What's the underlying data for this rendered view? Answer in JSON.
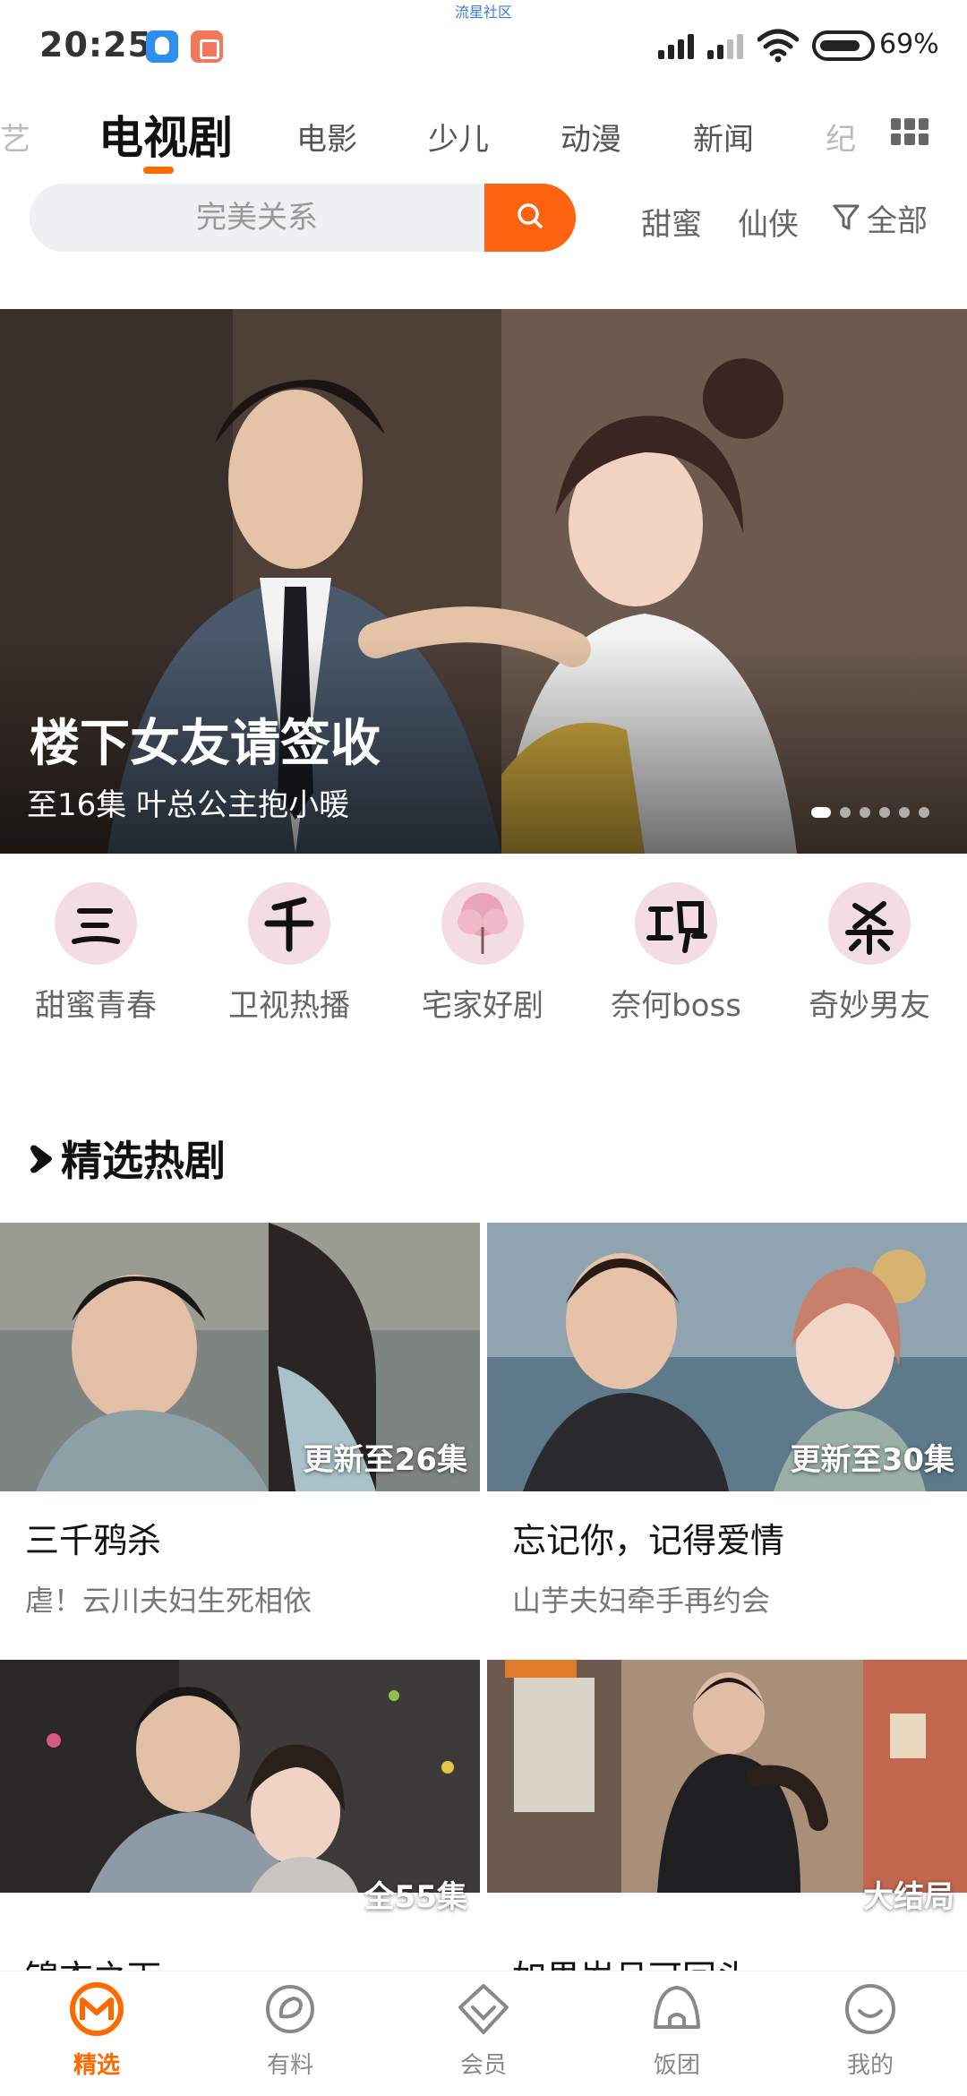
{
  "status_bar": {
    "watermark": "流星社区",
    "time": "20:25",
    "battery": "69%"
  },
  "tabs": {
    "items": [
      "艺",
      "电视剧",
      "电影",
      "少儿",
      "动漫",
      "新闻",
      "纪"
    ],
    "active": "电视剧"
  },
  "search": {
    "placeholder": "完美关系",
    "quick_tags": [
      "甜蜜",
      "仙侠"
    ],
    "filter_label": "全部"
  },
  "banner": {
    "title": "楼下女友请签收",
    "subtitle": "至16集 叶总公主抱小暖",
    "page_count": 6,
    "active_page": 1
  },
  "channels": [
    {
      "label": "甜蜜青春",
      "glyph": "三"
    },
    {
      "label": "卫视热播",
      "glyph": "千"
    },
    {
      "label": "宅家好剧",
      "glyph": ""
    },
    {
      "label": "奈何boss",
      "glyph": "鸦"
    },
    {
      "label": "奇妙男友",
      "glyph": "杀"
    }
  ],
  "section": {
    "title": "精选热剧"
  },
  "cards": [
    {
      "title": "三千鸦杀",
      "desc": "虐！云川夫妇生死相依",
      "badge": "更新至26集"
    },
    {
      "title": "忘记你，记得爱情",
      "desc": "山芋夫妇牵手再约会",
      "badge": "更新至30集"
    },
    {
      "title": "锦衣之下",
      "desc": "",
      "badge": "全55集"
    },
    {
      "title": "如果岁月可回头",
      "desc": "",
      "badge": "大结局"
    }
  ],
  "bottom_nav": {
    "items": [
      {
        "label": "精选",
        "icon": "home-m-icon",
        "active": true
      },
      {
        "label": "有料",
        "icon": "discover-icon",
        "active": false
      },
      {
        "label": "会员",
        "icon": "vip-diamond-icon",
        "active": false
      },
      {
        "label": "饭团",
        "icon": "fan-group-icon",
        "active": false
      },
      {
        "label": "我的",
        "icon": "profile-smile-icon",
        "active": false
      }
    ]
  },
  "colors": {
    "accent": "#ff6a00",
    "search_button": "#ff6310"
  }
}
